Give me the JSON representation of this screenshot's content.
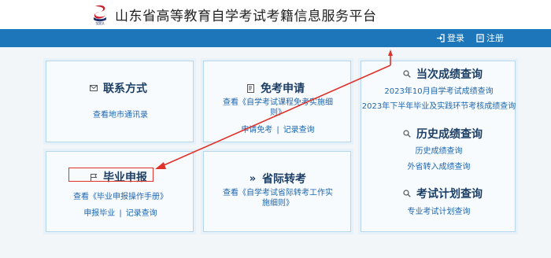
{
  "header": {
    "title": "山东省高等教育自学考试考籍信息服务平台"
  },
  "topbar": {
    "login": "登录",
    "register": "注册"
  },
  "cards": {
    "contact": {
      "title": "联系方式",
      "link": "查看地市通讯录"
    },
    "exemption": {
      "title": "免考申请",
      "desc": "查看《自学考试课程免考实施细则》",
      "apply": "申请免考",
      "records": "记录查询"
    },
    "graduation": {
      "title": "毕业申报",
      "desc": "查看《毕业申报操作手册》",
      "apply": "申报毕业",
      "records": "记录查询"
    },
    "transfer": {
      "title": "省际转考",
      "desc": "查看《自学考试省际转考工作实施细则》"
    },
    "current_scores": {
      "title": "当次成绩查询",
      "link1": "2023年10月自学考试成绩查询",
      "link2": "2023年下半年毕业及实践环节考核成绩查询"
    },
    "history_scores": {
      "title": "历史成绩查询",
      "link1": "历史成绩查询",
      "link2": "外省转入成绩查询"
    },
    "exam_plan": {
      "title": "考试计划查询",
      "link1": "专业考试计划查询"
    }
  },
  "colors": {
    "topbar": "#1c76b9",
    "link": "#1f66ad",
    "title": "#1d3f66",
    "annotation": "#e0312b"
  }
}
